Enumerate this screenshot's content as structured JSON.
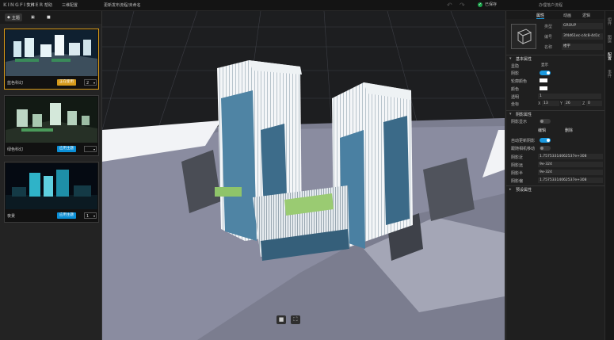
{
  "app": {
    "logo": "KINGFISHER"
  },
  "menu": {
    "items": [
      "文件",
      "帮助",
      "三维配置",
      "更新发布流程/未命名"
    ]
  },
  "status": {
    "save_label": "已保存",
    "project_name": "办理落户流程"
  },
  "left": {
    "tabs": [
      {
        "label": "主题",
        "icon": "theme-icon"
      },
      {
        "label": "",
        "icon": "image-icon"
      },
      {
        "label": "",
        "icon": "video-icon"
      }
    ],
    "cards": [
      {
        "name": "蓝色科幻",
        "button": "正在使用",
        "value": "2",
        "selected": true
      },
      {
        "name": "绿色科幻",
        "button": "应用主题",
        "value": "",
        "selected": false
      },
      {
        "name": "夜景",
        "button": "应用主题",
        "value": "1",
        "selected": false
      }
    ]
  },
  "viewport": {
    "buttons": [
      {
        "icon": "camera-icon"
      },
      {
        "icon": "fullscreen-icon"
      }
    ]
  },
  "right": {
    "tabs": [
      "属性",
      "动画",
      "逻辑"
    ],
    "info": [
      {
        "label": "类型",
        "value": "GROUP"
      },
      {
        "label": "编号",
        "value": "3f4d61ec-c4c8-4d1c"
      },
      {
        "label": "名称",
        "value": "楼宇"
      }
    ],
    "sections": {
      "basic": "基本属性",
      "shadow": "阴影属性",
      "material": "预设属性"
    },
    "basic": {
      "visible_label": "显隐",
      "visible_value": "显示",
      "shadow_label": "阴影",
      "wire_label": "轮廓颜色",
      "emit_label": "颜色",
      "opacity_label": "透明",
      "opacity_value": "1",
      "pos_label": "坐标",
      "pos": {
        "x": "13",
        "y": "26",
        "z": "0"
      }
    },
    "shadow": {
      "enable_label": "阴影显示",
      "edit_btn": "编辑",
      "delete_btn": "删除"
    },
    "mat": {
      "realtime_label": "自动更新阴影",
      "follow_label": "跟随相机移动",
      "rows": [
        {
          "label": "阴影近",
          "value": "1.75753314062537e+308"
        },
        {
          "label": "阴影远",
          "value": "9e-324"
        },
        {
          "label": "阴影半",
          "value": "9e-324"
        },
        {
          "label": "阴影偏",
          "value": "1.75753314062537e+308"
        }
      ]
    },
    "side_tabs": [
      "组件",
      "图层",
      "配置",
      "事件"
    ]
  },
  "colors": {
    "accent": "#1a9ae0",
    "selected_border": "#d69a1a",
    "save_ok": "#1aa34a"
  }
}
